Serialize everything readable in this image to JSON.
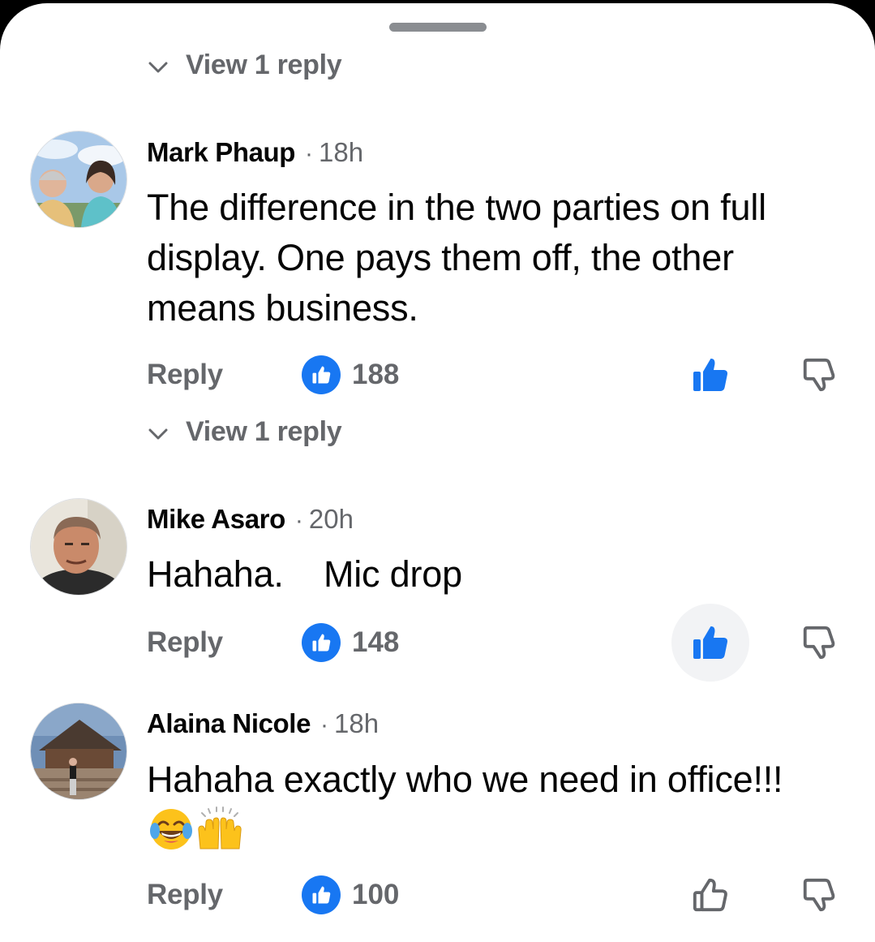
{
  "view_replies_top": {
    "label": "View 1 reply"
  },
  "comments": [
    {
      "author": "Mark Phaup",
      "separator": "·",
      "time": "18h",
      "text": "The difference in the two parties on full display. One pays them off, the other means business.",
      "reply_label": "Reply",
      "reaction_count": "188",
      "liked": true,
      "view_replies_label": "View 1 reply"
    },
    {
      "author": "Mike Asaro",
      "separator": "·",
      "time": "20h",
      "text": "Hahaha.    Mic drop",
      "reply_label": "Reply",
      "reaction_count": "148",
      "liked": true
    },
    {
      "author": "Alaina Nicole",
      "separator": "·",
      "time": "18h",
      "text": "Hahaha exactly who we need in office!!!",
      "emojis": [
        "face-with-tears-of-joy-emoji",
        "raising-hands-emoji"
      ],
      "reply_label": "Reply",
      "reaction_count": "100",
      "liked": false
    }
  ],
  "colors": {
    "accent_blue": "#1877f2",
    "secondary_text": "#65676b",
    "primary_text": "#050505",
    "pressed_bg": "#f2f3f5"
  }
}
